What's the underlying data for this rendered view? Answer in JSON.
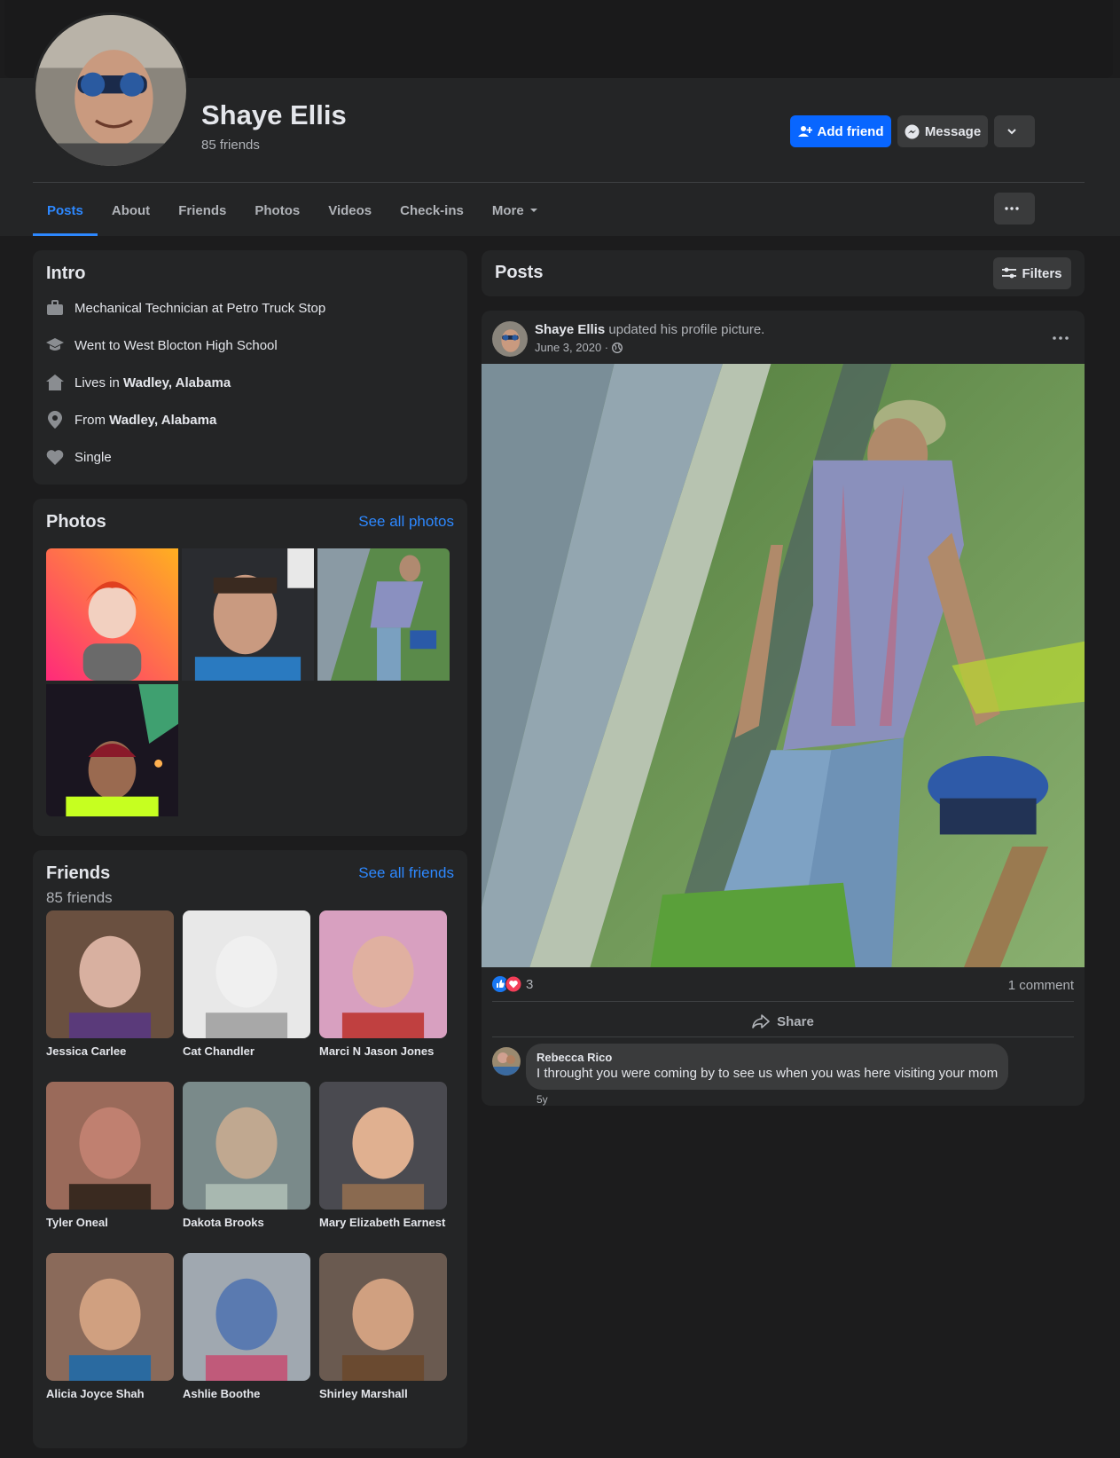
{
  "profile": {
    "name": "Shaye Ellis",
    "friend_count_label": "85 friends"
  },
  "header_actions": {
    "add_friend": "Add friend",
    "message": "Message"
  },
  "tabs": [
    {
      "label": "Posts",
      "active": true
    },
    {
      "label": "About"
    },
    {
      "label": "Friends"
    },
    {
      "label": "Photos"
    },
    {
      "label": "Videos"
    },
    {
      "label": "Check-ins"
    },
    {
      "label": "More"
    }
  ],
  "intro": {
    "title": "Intro",
    "work": "Mechanical Technician at Petro Truck Stop",
    "education": "Went to West Blocton High School",
    "lives_prefix": "Lives in ",
    "lives_place": "Wadley, Alabama",
    "from_prefix": "From ",
    "from_place": "Wadley, Alabama",
    "relationship": "Single"
  },
  "photos": {
    "title": "Photos",
    "see_all": "See all photos"
  },
  "friends": {
    "title": "Friends",
    "count_label": "85 friends",
    "see_all": "See all friends",
    "list": [
      {
        "name": "Jessica Carlee"
      },
      {
        "name": "Cat Chandler"
      },
      {
        "name": "Marci N Jason Jones"
      },
      {
        "name": "Tyler Oneal"
      },
      {
        "name": "Dakota Brooks"
      },
      {
        "name": "Mary Elizabeth Earnest"
      },
      {
        "name": "Alicia Joyce Shah"
      },
      {
        "name": "Ashlie Boothe"
      },
      {
        "name": "Shirley Marshall"
      }
    ]
  },
  "posts": {
    "title": "Posts",
    "filters": "Filters"
  },
  "post": {
    "author": "Shaye Ellis",
    "action": " updated his profile picture.",
    "date": "June 3, 2020 ·",
    "reaction_count": "3",
    "comment_count": "1 comment",
    "share": "Share",
    "comment": {
      "author": "Rebecca Rico",
      "text": "I throught you were coming by to see us when you was here visiting your mom",
      "age": "5y"
    }
  },
  "colors": {
    "accent": "#0866ff",
    "link": "#2d88ff",
    "card": "#242526",
    "background": "#1c1c1d"
  }
}
